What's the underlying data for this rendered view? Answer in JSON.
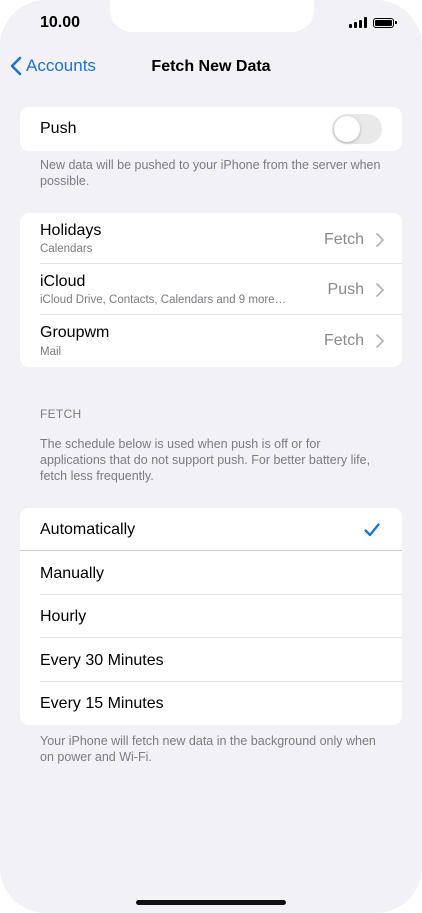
{
  "status": {
    "time": "10.00"
  },
  "nav": {
    "back_label": "Accounts",
    "title": "Fetch New Data"
  },
  "push": {
    "label": "Push",
    "enabled": false,
    "footer": "New data will be pushed to your iPhone from the server when possible."
  },
  "accounts": [
    {
      "title": "Holidays",
      "subtitle": "Calendars",
      "value": "Fetch"
    },
    {
      "title": "iCloud",
      "subtitle": "iCloud Drive, Contacts, Calendars and 9 more…",
      "value": "Push"
    },
    {
      "title": "Groupwm",
      "subtitle": "Mail",
      "value": "Fetch"
    }
  ],
  "fetch": {
    "header": "FETCH",
    "description": "The schedule below is used when push is off or for applications that do not support push. For better battery life, fetch less frequently.",
    "options": [
      "Automatically",
      "Manually",
      "Hourly",
      "Every 30 Minutes",
      "Every 15 Minutes"
    ],
    "selected": "Automatically",
    "footer": "Your iPhone will fetch new data in the background only when on power and Wi-Fi."
  },
  "colors": {
    "accent": "#1a73d6",
    "background": "#f1f1f6",
    "secondary_text": "#7b7b80"
  }
}
